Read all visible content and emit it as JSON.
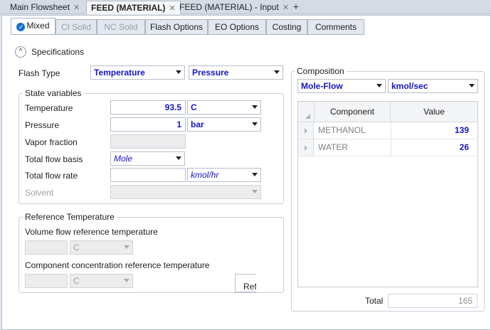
{
  "doc_tabs": [
    {
      "label": "Main Flowsheet",
      "close": "✕"
    },
    {
      "label": "FEED (MATERIAL)",
      "close": "✕"
    },
    {
      "label": "FEED (MATERIAL) - Input",
      "close": "✕"
    }
  ],
  "new_tab": "+",
  "form_tabs": [
    "Mixed",
    "CI Solid",
    "NC Solid",
    "Flash Options",
    "EO Options",
    "Costing",
    "Comments"
  ],
  "specifications": {
    "title": "Specifications",
    "collapse": "^"
  },
  "flash_type": {
    "label": "Flash Type",
    "spec1": "Temperature",
    "spec2": "Pressure"
  },
  "state_vars": {
    "title": "State variables",
    "temperature": {
      "label": "Temperature",
      "value": "93.5",
      "unit": "C"
    },
    "pressure": {
      "label": "Pressure",
      "value": "1",
      "unit": "bar"
    },
    "vapor_fraction": {
      "label": "Vapor fraction"
    },
    "flow_basis": {
      "label": "Total flow basis",
      "value": "Mole"
    },
    "flow_rate": {
      "label": "Total flow rate",
      "unit": "kmol/hr"
    },
    "solvent": {
      "label": "Solvent"
    }
  },
  "ref_temp": {
    "title": "Reference Temperature",
    "vol_label": "Volume flow reference temperature",
    "vol_unit": "C",
    "conc_label": "Component concentration reference temperature",
    "conc_unit": "C",
    "ref_button": "Ref"
  },
  "composition": {
    "title": "Composition",
    "basis": "Mole-Flow",
    "unit": "kmol/sec",
    "columns": [
      "Component",
      "Value"
    ],
    "rows": [
      {
        "component": "METHANOL",
        "value": "139"
      },
      {
        "component": "WATER",
        "value": "26"
      }
    ],
    "total_label": "Total",
    "total_value": "165"
  },
  "colors": {
    "accent_blue": "#1515c8",
    "check_blue": "#1a6fd1"
  }
}
